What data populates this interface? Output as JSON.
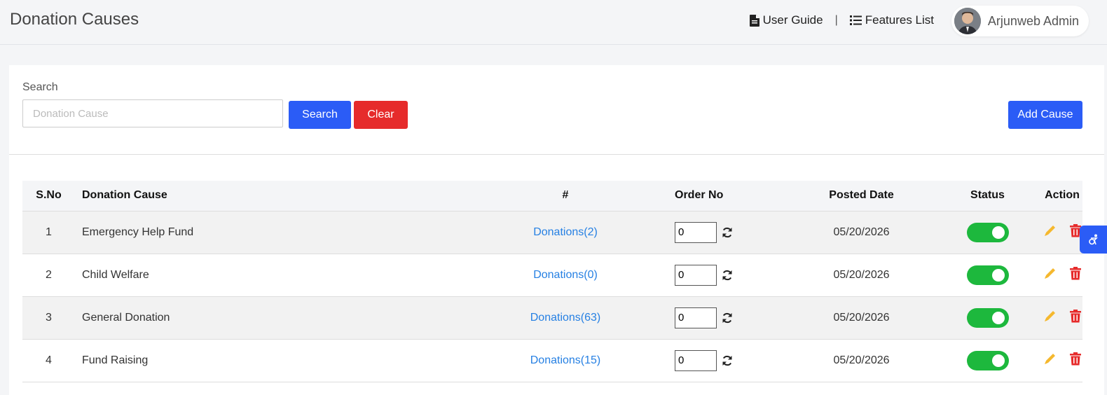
{
  "header": {
    "title": "Donation Causes",
    "links": [
      {
        "label": "User Guide",
        "icon": "file-icon"
      },
      {
        "label": "Features List",
        "icon": "list-icon"
      }
    ],
    "separator": "|",
    "user": {
      "name": "Arjunweb Admin",
      "avatar": "avatar"
    }
  },
  "search": {
    "label": "Search",
    "placeholder": "Donation Cause",
    "value": "",
    "search_button": "Search",
    "clear_button": "Clear",
    "add_button": "Add Cause"
  },
  "table": {
    "columns": [
      "S.No",
      "Donation Cause",
      "#",
      "Order No",
      "Posted Date",
      "Status",
      "Action"
    ],
    "rows": [
      {
        "sno": "1",
        "cause": "Emergency Help Fund",
        "donations": "Donations(2)",
        "order": "0",
        "date": "05/20/2026",
        "status": true
      },
      {
        "sno": "2",
        "cause": "Child Welfare",
        "donations": "Donations(0)",
        "order": "0",
        "date": "05/20/2026",
        "status": true
      },
      {
        "sno": "3",
        "cause": "General Donation",
        "donations": "Donations(63)",
        "order": "0",
        "date": "05/20/2026",
        "status": true
      },
      {
        "sno": "4",
        "cause": "Fund Raising",
        "donations": "Donations(15)",
        "order": "0",
        "date": "05/20/2026",
        "status": true
      }
    ]
  },
  "colors": {
    "primary": "#2b5cf6",
    "danger": "#e62b2b",
    "link": "#2680e3",
    "toggle_on": "#1db83d",
    "edit_icon": "#f5b82e",
    "delete_icon": "#e62b2b"
  }
}
